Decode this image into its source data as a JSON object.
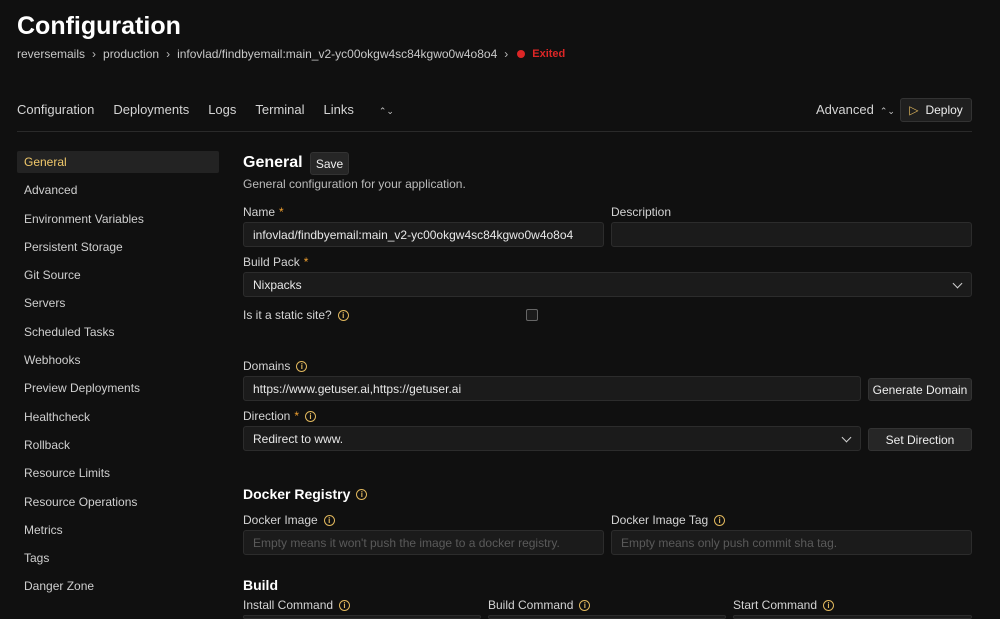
{
  "header": {
    "title": "Configuration",
    "breadcrumbs": [
      "reversemails",
      "production",
      "infovlad/findbyemail:main_v2-yc00okgw4sc84kgwo0w4o8o4"
    ],
    "status": "Exited"
  },
  "nav": {
    "tabs": [
      "Configuration",
      "Deployments",
      "Logs",
      "Terminal",
      "Links"
    ],
    "advanced": "Advanced",
    "deploy": "Deploy"
  },
  "sidebar": {
    "items": [
      "General",
      "Advanced",
      "Environment Variables",
      "Persistent Storage",
      "Git Source",
      "Servers",
      "Scheduled Tasks",
      "Webhooks",
      "Preview Deployments",
      "Healthcheck",
      "Rollback",
      "Resource Limits",
      "Resource Operations",
      "Metrics",
      "Tags",
      "Danger Zone"
    ],
    "active": "General"
  },
  "general": {
    "title": "General",
    "save": "Save",
    "description": "General configuration for your application.",
    "name_label": "Name",
    "name_value": "infovlad/findbyemail:main_v2-yc00okgw4sc84kgwo0w4o8o4",
    "description_label": "Description",
    "description_value": "",
    "build_pack_label": "Build Pack",
    "build_pack_value": "Nixpacks",
    "static_label": "Is it a static site?",
    "domains_label": "Domains",
    "domains_value": "https://www.getuser.ai,https://getuser.ai",
    "generate_domain": "Generate Domain",
    "direction_label": "Direction",
    "direction_value": "Redirect to www.",
    "set_direction": "Set Direction"
  },
  "docker": {
    "title": "Docker Registry",
    "image_label": "Docker Image",
    "image_placeholder": "Empty means it won't push the image to a docker registry.",
    "tag_label": "Docker Image Tag",
    "tag_placeholder": "Empty means only push commit sha tag."
  },
  "build": {
    "title": "Build",
    "install_label": "Install Command",
    "build_label": "Build Command",
    "start_label": "Start Command"
  },
  "colors": {
    "accent": "#e0b75d",
    "status_exited": "#dc2626",
    "background": "#101010"
  }
}
